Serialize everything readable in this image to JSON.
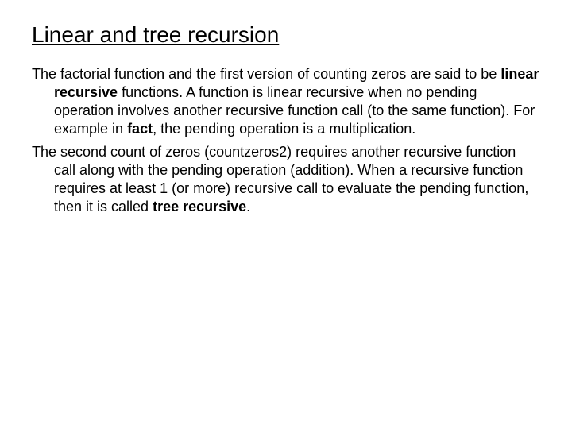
{
  "title": "Linear and tree recursion",
  "p1a": "The factorial function and the first version of counting zeros are said to be ",
  "p1b": "linear recursive",
  "p1c": " functions. A function is linear recursive when no pending operation involves another recursive function call (to the same function). For example in ",
  "p1d": "fact",
  "p1e": ", the pending operation is a multiplication.",
  "p2a": "The second count of zeros (countzeros2) requires another recursive function call along with the pending operation (addition). When a recursive function requires at least 1 (or more) recursive call to evaluate the pending function, then it is called ",
  "p2b": "tree recursive",
  "p2c": "."
}
